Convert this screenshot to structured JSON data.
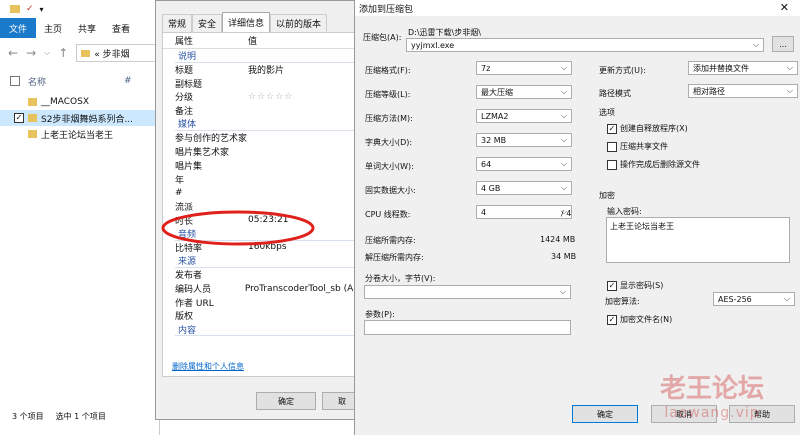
{
  "explorer": {
    "qat": [
      "▪",
      "✓",
      "▾"
    ],
    "ribbon_tabs": [
      "文件",
      "主页",
      "共享",
      "查看"
    ],
    "breadcrumb": "«  步非烟",
    "header": {
      "name": "名称",
      "col2": "#"
    },
    "items": [
      {
        "name": "__MACOSX",
        "checked": false,
        "selected": false
      },
      {
        "name": "S2步非烟舞妈系列合...",
        "checked": true,
        "selected": true
      },
      {
        "name": "上老王论坛当老王",
        "checked": false,
        "selected": false
      }
    ],
    "status_count": "3 个项目",
    "status_selected": "选中 1 个项目"
  },
  "props": {
    "tabs": [
      "常规",
      "安全",
      "详细信息",
      "以前的版本"
    ],
    "header": {
      "prop": "属性",
      "val": "值"
    },
    "rows": [
      {
        "k": "说明",
        "v": "",
        "sec": true
      },
      {
        "k": "标题",
        "v": "我的影片"
      },
      {
        "k": "副标题",
        "v": ""
      },
      {
        "k": "分级",
        "v": "☆☆☆☆☆",
        "stars": true
      },
      {
        "k": "备注",
        "v": ""
      },
      {
        "k": "媒体",
        "v": "",
        "sec": true
      },
      {
        "k": "参与创作的艺术家",
        "v": ""
      },
      {
        "k": "唱片集艺术家",
        "v": ""
      },
      {
        "k": "唱片集",
        "v": ""
      },
      {
        "k": "年",
        "v": ""
      },
      {
        "k": "#",
        "v": ""
      },
      {
        "k": "流派",
        "v": ""
      },
      {
        "k": "时长",
        "v": "05:23:21"
      },
      {
        "k": "音频",
        "v": "",
        "sec": true
      },
      {
        "k": "比特率",
        "v": "160kbps"
      },
      {
        "k": "来源",
        "v": "",
        "sec": true
      },
      {
        "k": "发布者",
        "v": ""
      },
      {
        "k": "编码人员",
        "v": "ProTranscoderTool_sb (Ap"
      },
      {
        "k": "作者 URL",
        "v": ""
      },
      {
        "k": "版权",
        "v": ""
      },
      {
        "k": "内容",
        "v": "",
        "sec": true
      }
    ],
    "remove_link": "删除属性和个人信息",
    "ok": "确定",
    "cancel": "取"
  },
  "rar": {
    "title": "添加到压缩包",
    "archive_label": "压缩包(A):",
    "archive_path": "D:\\迅雷下载\\步非烟\\",
    "archive_name": "yyjmxl.exe",
    "browse": "...",
    "format_label": "压缩格式(F):",
    "format": "7z",
    "level_label": "压缩等级(L):",
    "level": "最大压缩",
    "method_label": "压缩方法(M):",
    "method": "LZMA2",
    "dict_label": "字典大小(D):",
    "dict": "32 MB",
    "word_label": "单词大小(W):",
    "word": "64",
    "solid_label": "固实数据大小:",
    "solid": "4 GB",
    "cpu_label": "CPU 线程数:",
    "cpu": "4",
    "cpu_total": "/ 4",
    "mem_c_label": "压缩所需内存:",
    "mem_c": "1424 MB",
    "mem_d_label": "解压缩所需内存:",
    "mem_d": "34 MB",
    "split_label": "分卷大小，字节(V):",
    "params_label": "参数(P):",
    "update_label": "更新方式(U):",
    "update": "添加并替换文件",
    "pathmode_label": "路径模式",
    "pathmode": "相对路径",
    "options_title": "选项",
    "opt1": "创建自释放程序(X)",
    "opt1_checked": true,
    "opt2": "压缩共享文件",
    "opt2_checked": false,
    "opt3": "操作完成后删除源文件",
    "opt3_checked": false,
    "enc_title": "加密",
    "pwd_label": "输入密码:",
    "pwd_value": "上老王论坛当老王",
    "show_pwd": "显示密码(S)",
    "show_pwd_checked": true,
    "enc_method_label": "加密算法:",
    "enc_method": "AES-256",
    "enc_names": "加密文件名(N)",
    "enc_names_checked": true,
    "ok": "确定",
    "cancel": "取消",
    "help": "帮助"
  },
  "watermark": {
    "line1": "老王论坛",
    "line2": "laowang.vip"
  },
  "colors": {
    "accent": "#1979ca",
    "ellipse": "#e0201a",
    "section": "#2a55a5"
  }
}
